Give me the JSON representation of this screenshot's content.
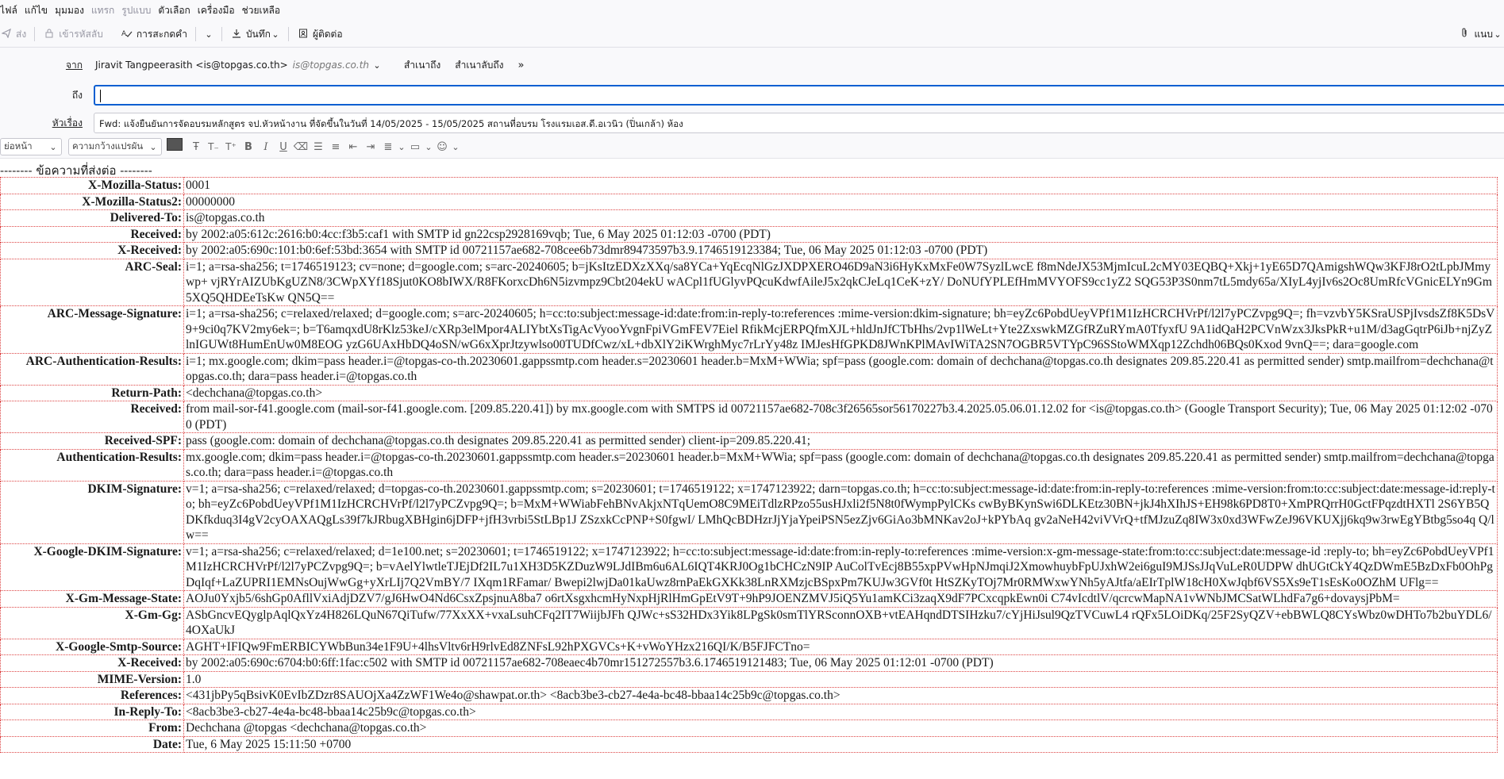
{
  "menu": [
    {
      "label": "ไฟล์",
      "enabled": true
    },
    {
      "label": "แก้ไข",
      "enabled": true
    },
    {
      "label": "มุมมอง",
      "enabled": true
    },
    {
      "label": "แทรก",
      "enabled": false
    },
    {
      "label": "รูปแบบ",
      "enabled": false
    },
    {
      "label": "ตัวเลือก",
      "enabled": true
    },
    {
      "label": "เครื่องมือ",
      "enabled": true
    },
    {
      "label": "ช่วยเหลือ",
      "enabled": true
    }
  ],
  "toolbar": {
    "send": "ส่ง",
    "encrypt": "เข้ารหัสลับ",
    "spelling": "การสะกดคำ",
    "save": "บันทึก",
    "contacts": "ผู้ติดต่อ",
    "attach": "แนบ"
  },
  "header": {
    "from_label": "จาก",
    "from_name": "Jiravit Tangpeerasith <is@topgas.co.th>",
    "from_email": "is@topgas.co.th",
    "cc": "สำเนาถึง",
    "bcc": "สำเนาลับถึง",
    "to_label": "ถึง",
    "to_value": "",
    "subject_label": "หัวเรื่อง",
    "subject_value": "Fwd: แจ้งยืนยันการจัดอบรมหลักสูตร จป.หัวหน้างาน ที่จัดขึ้นในวันที่ 14/05/2025 - 15/05/2025 สถานที่อบรม โรงแรมเอส.ดี.อเวนิว (ปิ่นเกล้า) ห้อง"
  },
  "format": {
    "paragraph": "ย่อหน้า",
    "font": "ความกว้างแปรผัน"
  },
  "body": {
    "forward_line": "-------- ข้อความที่ส่งต่อ --------",
    "headers": [
      {
        "k": "X-Mozilla-Status:",
        "v": "0001"
      },
      {
        "k": "X-Mozilla-Status2:",
        "v": "00000000"
      },
      {
        "k": "Delivered-To:",
        "v": "is@topgas.co.th"
      },
      {
        "k": "Received:",
        "v": "by 2002:a05:612c:2616:b0:4cc:f3b5:caf1 with SMTP id gn22csp2928169vqb; Tue, 6 May 2025 01:12:03 -0700 (PDT)"
      },
      {
        "k": "X-Received:",
        "v": "by 2002:a05:690c:101:b0:6ef:53bd:3654 with SMTP id 00721157ae682-708cee6b73dmr89473597b3.9.1746519123384; Tue, 06 May 2025 01:12:03 -0700 (PDT)"
      },
      {
        "k": "ARC-Seal:",
        "v": "i=1; a=rsa-sha256; t=1746519123; cv=none; d=google.com; s=arc-20240605; b=jKsItzEDXzXXq/sa8YCa+YqEcqNlGzJXDPXERO46D9aN3i6HyKxMxFe0W7SyzlLwcE f8mNdeJX53MjmIcuL2cMY03EQBQ+Xkj+1yE65D7QAmigshWQw3KFJ8rO2tLpbJMmywp+ vjRYrAIZUbKgUZN8/3CWpXYf18Sjut0KO8bIWX/R8FKorxcDh6N5izvmpz9Cbt204ekU wACpl1fUGlyvPQcuKdwfAileJ5x2qkCJeLq1CeK+zY/ DoNUfYPLEfHmMVYOFS9cc1yZ2 SQG53P3S0nm7tL5mdy65a/XIyL4yjIv6s2Oc8UmRfcVGnicELYn9Gm5XQ5QHDEeTsKw QN5Q=="
      },
      {
        "k": "ARC-Message-Signature:",
        "v": "i=1; a=rsa-sha256; c=relaxed/relaxed; d=google.com; s=arc-20240605; h=cc:to:subject:message-id:date:from:in-reply-to:references :mime-version:dkim-signature; bh=eyZc6PobdUeyVPf1M1IzHCRCHVrPf/l2l7yPCZvpg9Q=; fh=vzvbY5KSraUSPjIvsdsZf8K5DsV9+9ci0q7KV2my6ek=; b=T6amqxdU8rKlz53keJ/cXRp3elMpor4ALIYbtXsTigAcVyooYvgnFpiVGmFEV7Eiel RfikMcjERPQfmXJL+hldJnJfCTbHhs/2vp1lWeLt+Yte2ZxswkMZGfRZuRYmA0TfyxfU 9A1idQaH2PCVnWzx3JksPkR+u1M/d3agGqtrP6iJb+njZyZlnIGUWt8HumEnUw0M8EOG yzG6UAxHbDQ4oSN/wG6xXprJtzywlso00TUDfCwz/xL+dbXlY2iKWrghMyc7rLrYy48z IMJesHfGPKD8JWnKPlMAvIWiTA2SN7OGBR5VTYpC96SStoWMXqp12Zchdh06BQs0Kxod 9vnQ==; dara=google.com"
      },
      {
        "k": "ARC-Authentication-Results:",
        "v": "i=1; mx.google.com; dkim=pass header.i=@topgas-co-th.20230601.gappssmtp.com header.s=20230601 header.b=MxM+WWia; spf=pass (google.com: domain of dechchana@topgas.co.th designates 209.85.220.41 as permitted sender) smtp.mailfrom=dechchana@topgas.co.th; dara=pass header.i=@topgas.co.th"
      },
      {
        "k": "Return-Path:",
        "v": "<dechchana@topgas.co.th>"
      },
      {
        "k": "Received:",
        "v": "from mail-sor-f41.google.com (mail-sor-f41.google.com. [209.85.220.41]) by mx.google.com with SMTPS id 00721157ae682-708c3f26565sor56170227b3.4.2025.05.06.01.12.02 for <is@topgas.co.th> (Google Transport Security); Tue, 06 May 2025 01:12:02 -0700 (PDT)"
      },
      {
        "k": "Received-SPF:",
        "v": "pass (google.com: domain of dechchana@topgas.co.th designates 209.85.220.41 as permitted sender) client-ip=209.85.220.41;"
      },
      {
        "k": "Authentication-Results:",
        "v": "mx.google.com; dkim=pass header.i=@topgas-co-th.20230601.gappssmtp.com header.s=20230601 header.b=MxM+WWia; spf=pass (google.com: domain of dechchana@topgas.co.th designates 209.85.220.41 as permitted sender) smtp.mailfrom=dechchana@topgas.co.th; dara=pass header.i=@topgas.co.th"
      },
      {
        "k": "DKIM-Signature:",
        "v": "v=1; a=rsa-sha256; c=relaxed/relaxed; d=topgas-co-th.20230601.gappssmtp.com; s=20230601; t=1746519122; x=1747123922; darn=topgas.co.th; h=cc:to:subject:message-id:date:from:in-reply-to:references :mime-version:from:to:cc:subject:date:message-id:reply-to; bh=eyZc6PobdUeyVPf1M1IzHCRCHVrPf/l2l7yPCZvpg9Q=; b=MxM+WWiabFehBNvAkjxNTqUemO8C9MEiTdlzRPzo55usHJxli2f5N8t0fWympPylCKs cwByBKynSwi6DLKEtz30BN+jkJ4hXIhJS+EH98k6PD8T0+XmPRQrrH0GctFPqzdtHXTl 2S6YB5QDKfkduq3I4gV2cyOAXAQgLs39f7kJRbugXBHgin6jDFP+jfH3vrbi5StLBp1J ZSzxkCcPNP+S0fgwI/ LMhQcBDHzrJjYjaYpeiPSN5ezZjv6GiAo3bMNKav2oJ+kPYbAq gv2aNeH42viVVrQ+tfMJzuZq8IW3x0xd3WFwZeJ96VKUXjj6kq9w3rwEgYBtbg5so4q Q/lw=="
      },
      {
        "k": "X-Google-DKIM-Signature:",
        "v": "v=1; a=rsa-sha256; c=relaxed/relaxed; d=1e100.net; s=20230601; t=1746519122; x=1747123922; h=cc:to:subject:message-id:date:from:in-reply-to:references :mime-version:x-gm-message-state:from:to:cc:subject:date:message-id :reply-to; bh=eyZc6PobdUeyVPf1M1IzHCRCHVrPf/l2l7yPCZvpg9Q=; b=vAelYlwtleTJEjDf2IL7u1XH3D5KZDuzW9LJdIBm6u6AL6IQT4KRJ0Og1bCHCzN9IP AuColTvEcj8B55xpPVwHpNJmqiJ2XmowhuybFpUJxhW2ei6guI9MJSsJJqVuLeR0UDPW dhUGtCkY4QzDWmE5BzDxFb0OhPgDqIqf+LaZUPRI1EMNsOujWwGg+yXrLIj7Q2VmBY/7 IXqm1RFamar/ Bwepi2lwjDa01kaUwz8rnPaEkGXKk38LnRXMzjcBSpxPm7KUJw3GVf0t HtSZKyTOj7Mr0RMWxwYNh5yAJtfa/aEIrTplW18cH0XwJqbf6VS5Xs9eT1sEsKo0OZhM UFlg=="
      },
      {
        "k": "X-Gm-Message-State:",
        "v": "AOJu0Yxjb5/6shGp0AfllVxiAdjDZV7/gJ6HwO4Nd6CsxZpsjnuA8ba7 o6rtXsgxhcmHyNxpHjRlHmGpEtV9T+9hP9JOENZMVJ5iQ5Yu1amKCi3zaqX9dF7PCxcqpkEwn0i C74vIcdtlV/qcrcwMapNA1vWNbJMCSatWLhdFa7g6+dovaysjPbM="
      },
      {
        "k": "X-Gm-Gg:",
        "v": "ASbGncvEQyglpAqlQxYz4H826LQuN67QiTufw/77XxXX+vxaLsuhCFq2IT7WiijbJFh QJWc+sS32HDx3Yik8LPgSk0smTlYRSconnOXB+vtEAHqndDTSIHzku7/cYjHiJsul9QzTVCuwL4 rQFx5LOiDKq/25F2SyQZV+ebBWLQ8CYsWbz0wDHTo7b2buYDL6/4OXaUkJ"
      },
      {
        "k": "X-Google-Smtp-Source:",
        "v": "AGHT+IFIQw9FmERBICYWbBun34e1F9U+4lhsVltv6rH9rlvEd8ZNFsL92hPXGVCs+K+vWoYHzx216QI/K/B5FJFCTno="
      },
      {
        "k": "X-Received:",
        "v": "by 2002:a05:690c:6704:b0:6ff:1fac:c502 with SMTP id 00721157ae682-708eaec4b70mr151272557b3.6.1746519121483; Tue, 06 May 2025 01:12:01 -0700 (PDT)"
      },
      {
        "k": "MIME-Version:",
        "v": "1.0"
      },
      {
        "k": "References:",
        "v": "<431jbPy5qBsivK0EvIbZDzr8SAUOjXa4ZzWF1We4o@shawpat.or.th> <8acb3be3-cb27-4e4a-bc48-bbaa14c25b9c@topgas.co.th>"
      },
      {
        "k": "In-Reply-To:",
        "v": "<8acb3be3-cb27-4e4a-bc48-bbaa14c25b9c@topgas.co.th>"
      },
      {
        "k": "From:",
        "v": "Dechchana @topgas <dechchana@topgas.co.th>"
      },
      {
        "k": "Date:",
        "v": "Tue, 6 May 2025 15:11:50 +0700"
      }
    ]
  }
}
